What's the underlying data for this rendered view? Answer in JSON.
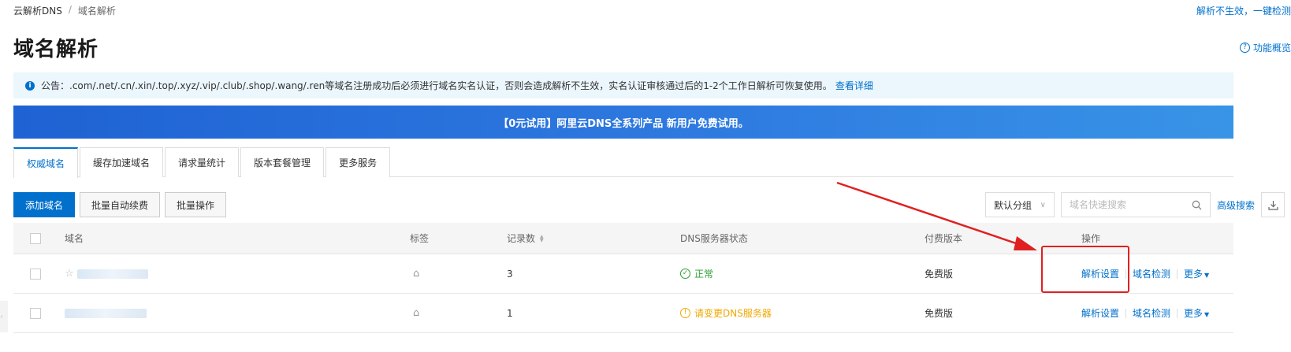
{
  "breadcrumb": {
    "root": "云解析DNS",
    "separator": "/",
    "current": "域名解析"
  },
  "top_link": "解析不生效，一键检测",
  "page_title": "域名解析",
  "overview_link": "功能概览",
  "notice": {
    "text": "公告：.com/.net/.cn/.xin/.top/.xyz/.vip/.club/.shop/.wang/.ren等域名注册成功后必须进行域名实名认证，否则会造成解析不生效，实名认证审核通过后的1-2个工作日解析可恢复使用。",
    "link": "查看详细"
  },
  "banner": "【0元试用】阿里云DNS全系列产品 新用户免费试用。",
  "tabs": [
    {
      "label": "权威域名",
      "active": true
    },
    {
      "label": "缓存加速域名"
    },
    {
      "label": "请求量统计"
    },
    {
      "label": "版本套餐管理"
    },
    {
      "label": "更多服务"
    }
  ],
  "toolbar": {
    "add": "添加域名",
    "batch_renew": "批量自动续费",
    "batch_ops": "批量操作"
  },
  "filters": {
    "group": "默认分组",
    "search_placeholder": "域名快速搜索",
    "advanced": "高级搜索"
  },
  "table": {
    "headers": {
      "domain": "域名",
      "tag": "标签",
      "records": "记录数",
      "dns_status": "DNS服务器状态",
      "edition": "付费版本",
      "ops": "操作"
    },
    "rows": [
      {
        "records": "3",
        "status": "正常",
        "status_type": "ok",
        "edition": "免费版",
        "op_resolve": "解析设置",
        "op_check": "域名检测",
        "op_more": "更多"
      },
      {
        "records": "1",
        "status": "请变更DNS服务器",
        "status_type": "warn",
        "edition": "免费版",
        "op_resolve": "解析设置",
        "op_check": "域名检测",
        "op_more": "更多"
      }
    ]
  },
  "colors": {
    "accent": "#0070cc",
    "ok": "#2e9e35",
    "warn": "#f0a800",
    "annotation": "#e02020"
  }
}
